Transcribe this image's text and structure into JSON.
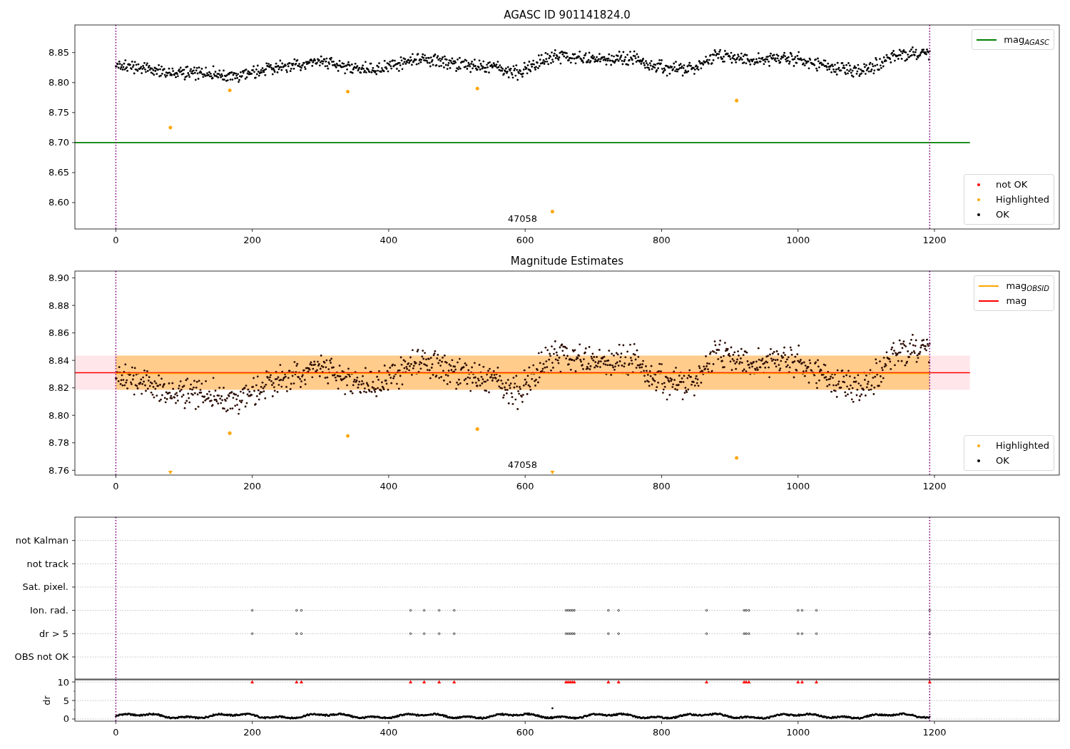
{
  "panels": [
    {
      "kind": "magnitude",
      "chart_data": {
        "type": "scatter",
        "title": "AGASC ID 901141824.0",
        "xlim": [
          -60,
          1383
        ],
        "ylim": [
          8.556,
          8.896
        ],
        "xticks": [
          0,
          200,
          400,
          600,
          800,
          1000,
          1200
        ],
        "yticks": [
          {
            "value": 8.6,
            "label": "8.60"
          },
          {
            "value": 8.65,
            "label": "8.65"
          },
          {
            "value": 8.7,
            "label": "8.70"
          },
          {
            "value": 8.75,
            "label": "8.75"
          },
          {
            "value": 8.8,
            "label": "8.80"
          },
          {
            "value": 8.85,
            "label": "8.85"
          }
        ],
        "x": [
          80,
          167,
          340,
          530,
          640,
          910
        ],
        "series": [
          {
            "name": "Highlighted",
            "color": "#ffa500",
            "values": [
              8.725,
              8.787,
              8.785,
              8.79,
              8.585,
              8.77
            ]
          }
        ],
        "ref_lines": [
          {
            "axis": "y",
            "value": 8.7,
            "color": "#008000"
          },
          {
            "axis": "x",
            "value": 0,
            "color": "#800080"
          },
          {
            "axis": "x",
            "value": 1193,
            "color": "#800080"
          }
        ],
        "annotations": [
          "47058"
        ]
      },
      "legends": [
        [
          {
            "label": "mag$_{AGASC}$",
            "kind": "line",
            "color": "#008000"
          }
        ],
        [
          {
            "label": "not OK",
            "kind": "dot",
            "color": "#ff0000"
          },
          {
            "kind": "series"
          },
          {
            "label": "OK",
            "kind": "dot",
            "color": "#000000"
          }
        ]
      ]
    },
    {
      "kind": "magnitude",
      "chart_data": {
        "type": "scatter",
        "title": "Magnitude Estimates",
        "xlim": [
          -60,
          1383
        ],
        "ylim": [
          8.7565,
          8.905
        ],
        "xticks": [
          0,
          200,
          400,
          600,
          800,
          1000,
          1200
        ],
        "yticks": [
          {
            "value": 8.76,
            "label": "8.76"
          },
          {
            "value": 8.78,
            "label": "8.78"
          },
          {
            "value": 8.8,
            "label": "8.80"
          },
          {
            "value": 8.82,
            "label": "8.82"
          },
          {
            "value": 8.84,
            "label": "8.84"
          },
          {
            "value": 8.86,
            "label": "8.86"
          },
          {
            "value": 8.88,
            "label": "8.88"
          },
          {
            "value": 8.9,
            "label": "8.90"
          }
        ],
        "x": [
          167,
          340,
          530,
          910
        ],
        "series": [
          {
            "name": "Highlighted",
            "color": "#ffa500",
            "values": [
              8.787,
              8.785,
              8.79,
              8.769
            ]
          }
        ],
        "bands": [
          {
            "axis": "y",
            "from": 8.8186,
            "to": 8.8435,
            "color": "#ffc0cb"
          },
          {
            "axis": "y",
            "from": 8.8186,
            "to": 8.8435,
            "color": "#ffa500"
          }
        ],
        "ref_lines": [
          {
            "axis": "y",
            "value": 8.831,
            "color": "#ff0000"
          },
          {
            "axis": "y",
            "value": 8.8305,
            "color": "#ffa500"
          },
          {
            "axis": "x",
            "value": 0,
            "color": "#800080"
          },
          {
            "axis": "x",
            "value": 1193,
            "color": "#800080"
          }
        ],
        "annotations": [
          "47058"
        ]
      },
      "below_axis_markers": {
        "color": "#ffa500"
      },
      "legends": [
        [
          {
            "label": "mag$_{OBSID}$",
            "kind": "line",
            "color": "#ffa500"
          },
          {
            "label": "mag",
            "kind": "line",
            "color": "#ff0000"
          }
        ],
        [
          {
            "kind": "series"
          },
          {
            "label": "OK",
            "kind": "dot",
            "color": "#000000"
          }
        ]
      ]
    },
    {
      "kind": "flags",
      "rows": [
        "not Kalman",
        "not track",
        "Sat. pixel.",
        "Ion. rad.",
        "dr > 5",
        "OBS not OK"
      ]
    },
    {
      "kind": "dr",
      "chart_data": {
        "type": "scatter",
        "ylabel": "dr",
        "xlim": [
          -60,
          1383
        ],
        "ylim": [
          -0.58,
          10.58
        ],
        "grid": true,
        "xticks": [
          0,
          200,
          400,
          600,
          800,
          1000,
          1200
        ],
        "yticks": [
          0,
          5,
          10
        ],
        "x": [
          200,
          265,
          272,
          432,
          452,
          474,
          496,
          660,
          663,
          666,
          669,
          672,
          722,
          737,
          866,
          921,
          924,
          928,
          1000,
          1006,
          1027,
          1193
        ],
        "series": [
          {
            "color": "#ff0000",
            "values": [
              10,
              10,
              10,
              10,
              10,
              10,
              10,
              10,
              10,
              10,
              10,
              10,
              10,
              10,
              10,
              10,
              10,
              10,
              10,
              10,
              10,
              10
            ]
          }
        ],
        "ref_lines": [
          {
            "axis": "x",
            "value": 0,
            "color": "#800080"
          },
          {
            "axis": "x",
            "value": 1193,
            "color": "#800080"
          }
        ]
      }
    }
  ]
}
